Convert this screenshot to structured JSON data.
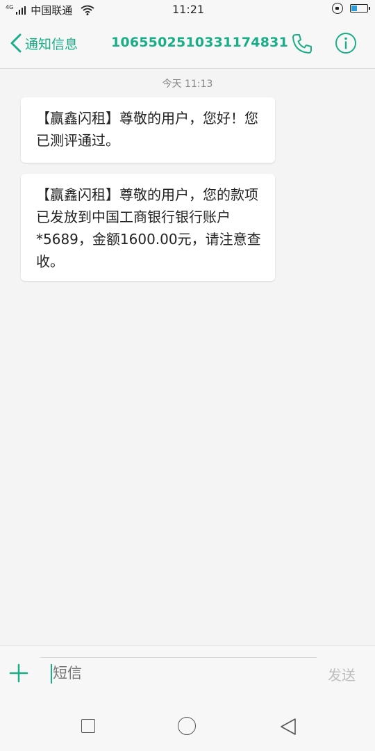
{
  "status_bar": {
    "network_type": "4G",
    "carrier": "中国联通",
    "time": "11:21",
    "battery_level": 0.35
  },
  "header": {
    "back_label": "通知信息",
    "sender_number": "1065502510331174831"
  },
  "conversation": {
    "timestamp": "今天 11:13",
    "messages": [
      {
        "text": "【赢鑫闪租】尊敬的用户，您好！您已测评通过。"
      },
      {
        "text": "【赢鑫闪租】尊敬的用户，您的款项已发放到中国工商银行银行账户*5689，金额1600.00元，请注意查收。"
      }
    ]
  },
  "composer": {
    "placeholder": "短信",
    "send_label": "发送"
  },
  "colors": {
    "accent": "#1aae88",
    "bubble": "#ffffff",
    "background": "#f4f4f4"
  },
  "icons": {
    "back": "chevron-left-icon",
    "call": "phone-icon",
    "info": "info-icon",
    "add": "plus-icon"
  }
}
